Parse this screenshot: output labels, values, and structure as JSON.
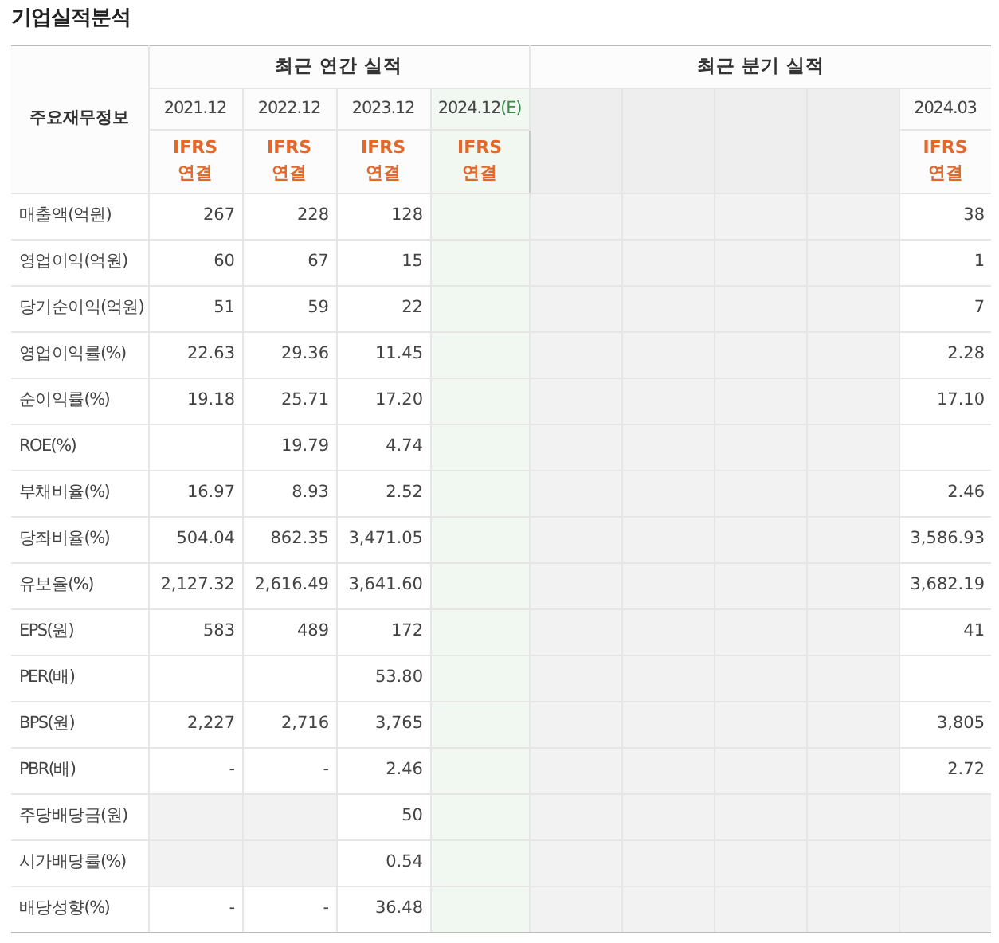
{
  "title": "기업실적분석",
  "header": {
    "row_label": "주요재무정보",
    "groups": [
      {
        "label": "최근 연간 실적",
        "columns": [
          {
            "period": "2021.12",
            "shaded": false,
            "basis": "IFRS\n연결"
          },
          {
            "period": "2022.12",
            "shaded": false,
            "basis": "IFRS\n연결"
          },
          {
            "period": "2023.12",
            "shaded": false,
            "basis": "IFRS\n연결"
          },
          {
            "period": "2024.12",
            "estimate_mark": "(E)",
            "shaded": false,
            "basis": "IFRS\n연결"
          }
        ]
      },
      {
        "label": "최근 분기 실적",
        "columns": [
          {
            "shaded": true
          },
          {
            "shaded": true
          },
          {
            "shaded": true
          },
          {
            "shaded": true
          },
          {
            "period": "2024.03",
            "shaded": false,
            "basis": "IFRS\n연결"
          }
        ]
      }
    ]
  },
  "sections": [
    {
      "rows": [
        {
          "label": "매출액(억원)",
          "cells": [
            {
              "value": "267",
              "shaded": false
            },
            {
              "value": "228",
              "shaded": false
            },
            {
              "value": "128",
              "shaded": false
            },
            {
              "shaded": false
            },
            {
              "shaded": true
            },
            {
              "shaded": true
            },
            {
              "shaded": true
            },
            {
              "shaded": true
            },
            {
              "value": "38",
              "shaded": false
            }
          ]
        },
        {
          "label": "영업이익(억원)",
          "cells": [
            {
              "value": "60",
              "shaded": false
            },
            {
              "value": "67",
              "shaded": false
            },
            {
              "value": "15",
              "shaded": false
            },
            {
              "shaded": false
            },
            {
              "shaded": true
            },
            {
              "shaded": true
            },
            {
              "shaded": true
            },
            {
              "shaded": true
            },
            {
              "value": "1",
              "shaded": false
            }
          ]
        },
        {
          "label": "당기순이익(억원)",
          "cells": [
            {
              "value": "51",
              "shaded": false
            },
            {
              "value": "59",
              "shaded": false
            },
            {
              "value": "22",
              "shaded": false
            },
            {
              "shaded": false
            },
            {
              "shaded": true
            },
            {
              "shaded": true
            },
            {
              "shaded": true
            },
            {
              "shaded": true
            },
            {
              "value": "7",
              "shaded": false
            }
          ]
        }
      ]
    },
    {
      "rows": [
        {
          "label": "영업이익률(%)",
          "cells": [
            {
              "value": "22.63",
              "shaded": false
            },
            {
              "value": "29.36",
              "shaded": false
            },
            {
              "value": "11.45",
              "shaded": false
            },
            {
              "shaded": false
            },
            {
              "shaded": true
            },
            {
              "shaded": true
            },
            {
              "shaded": true
            },
            {
              "shaded": true
            },
            {
              "value": "2.28",
              "shaded": false
            }
          ]
        },
        {
          "label": "순이익률(%)",
          "cells": [
            {
              "value": "19.18",
              "shaded": false
            },
            {
              "value": "25.71",
              "shaded": false
            },
            {
              "value": "17.20",
              "shaded": false
            },
            {
              "shaded": false
            },
            {
              "shaded": true
            },
            {
              "shaded": true
            },
            {
              "shaded": true
            },
            {
              "shaded": true
            },
            {
              "value": "17.10",
              "shaded": false
            }
          ]
        },
        {
          "label": "ROE(%)",
          "cells": [
            {
              "shaded": false
            },
            {
              "value": "19.79",
              "shaded": false
            },
            {
              "value": "4.74",
              "shaded": false
            },
            {
              "shaded": false
            },
            {
              "shaded": true
            },
            {
              "shaded": true
            },
            {
              "shaded": true
            },
            {
              "shaded": true
            },
            {
              "shaded": false
            }
          ]
        }
      ]
    },
    {
      "rows": [
        {
          "label": "부채비율(%)",
          "cells": [
            {
              "value": "16.97",
              "shaded": false
            },
            {
              "value": "8.93",
              "shaded": false
            },
            {
              "value": "2.52",
              "shaded": false
            },
            {
              "shaded": false
            },
            {
              "shaded": true
            },
            {
              "shaded": true
            },
            {
              "shaded": true
            },
            {
              "shaded": true
            },
            {
              "value": "2.46",
              "shaded": false
            }
          ]
        },
        {
          "label": "당좌비율(%)",
          "cells": [
            {
              "value": "504.04",
              "shaded": false
            },
            {
              "value": "862.35",
              "shaded": false
            },
            {
              "value": "3,471.05",
              "shaded": false
            },
            {
              "shaded": false
            },
            {
              "shaded": true
            },
            {
              "shaded": true
            },
            {
              "shaded": true
            },
            {
              "shaded": true
            },
            {
              "value": "3,586.93",
              "shaded": false
            }
          ]
        },
        {
          "label": "유보율(%)",
          "cells": [
            {
              "value": "2,127.32",
              "shaded": false
            },
            {
              "value": "2,616.49",
              "shaded": false
            },
            {
              "value": "3,641.60",
              "shaded": false
            },
            {
              "shaded": false
            },
            {
              "shaded": true
            },
            {
              "shaded": true
            },
            {
              "shaded": true
            },
            {
              "shaded": true
            },
            {
              "value": "3,682.19",
              "shaded": false
            }
          ]
        }
      ]
    },
    {
      "rows": [
        {
          "label": "EPS(원)",
          "cells": [
            {
              "value": "583",
              "shaded": false
            },
            {
              "value": "489",
              "shaded": false
            },
            {
              "value": "172",
              "shaded": false
            },
            {
              "shaded": false
            },
            {
              "shaded": true
            },
            {
              "shaded": true
            },
            {
              "shaded": true
            },
            {
              "shaded": true
            },
            {
              "value": "41",
              "shaded": false
            }
          ]
        },
        {
          "label": "PER(배)",
          "cells": [
            {
              "shaded": false
            },
            {
              "shaded": false
            },
            {
              "value": "53.80",
              "shaded": false
            },
            {
              "shaded": false
            },
            {
              "shaded": true
            },
            {
              "shaded": true
            },
            {
              "shaded": true
            },
            {
              "shaded": true
            },
            {
              "shaded": false
            }
          ]
        },
        {
          "label": "BPS(원)",
          "cells": [
            {
              "value": "2,227",
              "shaded": false
            },
            {
              "value": "2,716",
              "shaded": false
            },
            {
              "value": "3,765",
              "shaded": false
            },
            {
              "shaded": false
            },
            {
              "shaded": true
            },
            {
              "shaded": true
            },
            {
              "shaded": true
            },
            {
              "shaded": true
            },
            {
              "value": "3,805",
              "shaded": false
            }
          ]
        },
        {
          "label": "PBR(배)",
          "cells": [
            {
              "value": "-",
              "shaded": false
            },
            {
              "value": "-",
              "shaded": false
            },
            {
              "value": "2.46",
              "shaded": false
            },
            {
              "shaded": false
            },
            {
              "shaded": true
            },
            {
              "shaded": true
            },
            {
              "shaded": true
            },
            {
              "shaded": true
            },
            {
              "value": "2.72",
              "shaded": false
            }
          ]
        }
      ]
    },
    {
      "rows": [
        {
          "label": "주당배당금(원)",
          "cells": [
            {
              "shaded": true
            },
            {
              "shaded": true
            },
            {
              "value": "50",
              "shaded": false
            },
            {
              "shaded": false
            },
            {
              "shaded": true
            },
            {
              "shaded": true
            },
            {
              "shaded": true
            },
            {
              "shaded": true
            },
            {
              "shaded": true
            }
          ]
        },
        {
          "label": "시가배당률(%)",
          "cells": [
            {
              "shaded": true
            },
            {
              "shaded": true
            },
            {
              "value": "0.54",
              "shaded": false
            },
            {
              "shaded": false
            },
            {
              "shaded": true
            },
            {
              "shaded": true
            },
            {
              "shaded": true
            },
            {
              "shaded": true
            },
            {
              "shaded": true
            }
          ]
        },
        {
          "label": "배당성향(%)",
          "cells": [
            {
              "value": "-",
              "shaded": false
            },
            {
              "value": "-",
              "shaded": false
            },
            {
              "value": "36.48",
              "shaded": false
            },
            {
              "shaded": false
            },
            {
              "shaded": true
            },
            {
              "shaded": true
            },
            {
              "shaded": true
            },
            {
              "shaded": true
            },
            {
              "shaded": true
            }
          ]
        }
      ]
    }
  ]
}
